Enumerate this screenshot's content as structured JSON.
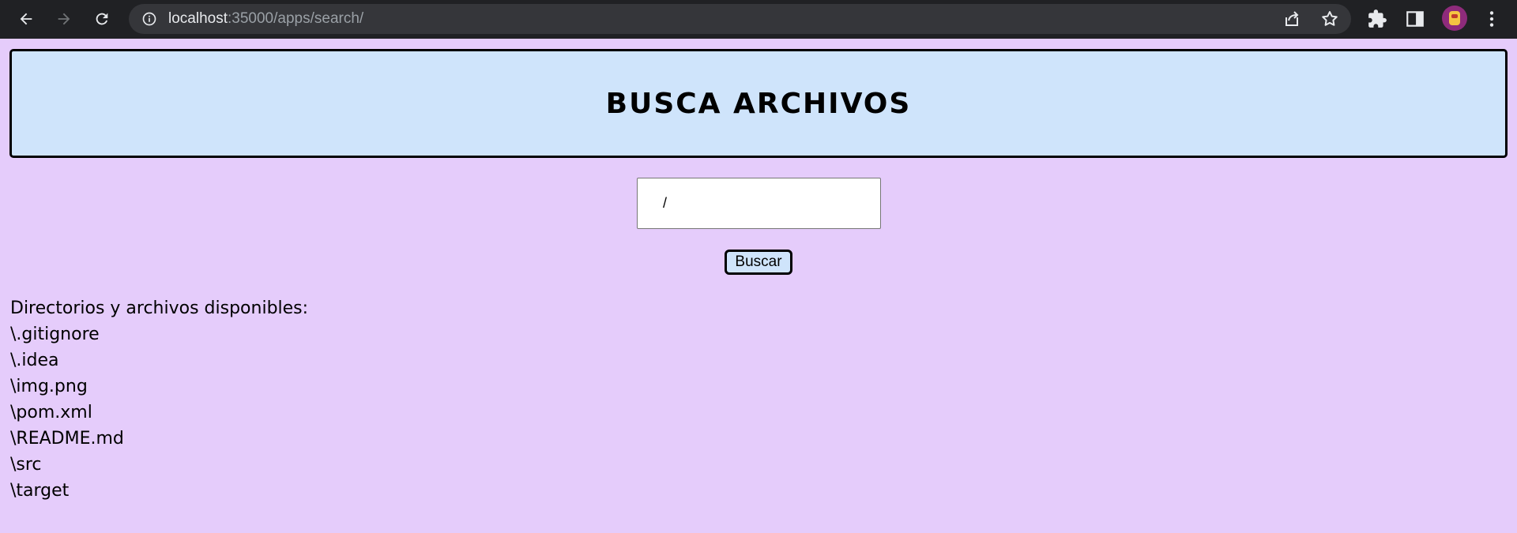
{
  "browser": {
    "url_host": "localhost",
    "url_rest": ":35000/apps/search/",
    "icons": [
      "back-icon",
      "forward-icon",
      "reload-icon",
      "info-icon",
      "share-icon",
      "star-icon",
      "extensions-icon",
      "side-panel-icon",
      "profile-avatar",
      "menu-icon"
    ]
  },
  "header": {
    "title": "BUSCA ARCHIVOS"
  },
  "search": {
    "value": "/"
  },
  "search_button": {
    "label": "Buscar"
  },
  "results": {
    "heading": "Directorios y archivos disponibles:",
    "items": [
      "\\.gitignore",
      "\\.idea",
      "\\img.png",
      "\\pom.xml",
      "\\README.md",
      "\\src",
      "\\target"
    ]
  },
  "colors": {
    "page_background": "#e5ccfb",
    "header_background": "#cfe4fb",
    "browser_bar": "#202124"
  }
}
